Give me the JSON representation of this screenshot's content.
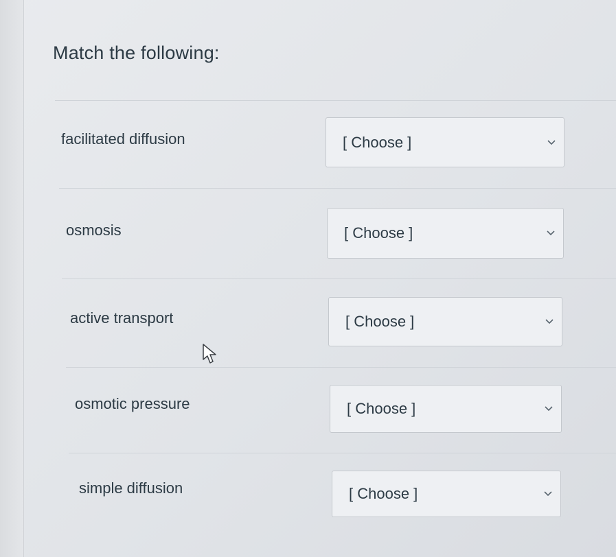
{
  "question": {
    "title": "Match the following:"
  },
  "rows": [
    {
      "term": "facilitated diffusion",
      "selected": "[ Choose ]"
    },
    {
      "term": "osmosis",
      "selected": "[ Choose ]"
    },
    {
      "term": "active transport",
      "selected": "[ Choose ]"
    },
    {
      "term": "osmotic pressure",
      "selected": "[ Choose ]"
    },
    {
      "term": "simple diffusion",
      "selected": "[ Choose ]"
    }
  ],
  "icons": {
    "dropdown": "chevron-down-icon",
    "pointer": "mouse-pointer-icon"
  }
}
